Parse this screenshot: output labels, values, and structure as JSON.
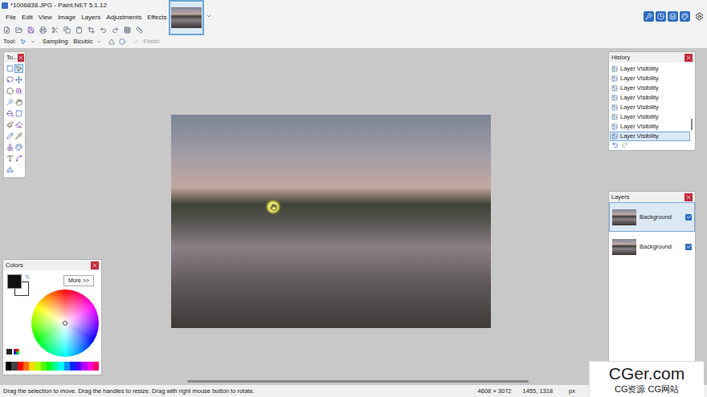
{
  "window": {
    "title": "*1006838.JPG - Paint.NET 5.1.12"
  },
  "menu": [
    "File",
    "Edit",
    "View",
    "Image",
    "Layers",
    "Adjustments",
    "Effects"
  ],
  "toolbar": {
    "tool_label": "Tool:",
    "sampling_label": "Sampling:",
    "sampling_value": "Bicubic",
    "finish": "Finish",
    "finish_disabled": true
  },
  "tools_window": {
    "title": "To..."
  },
  "history": {
    "title": "History",
    "items": [
      {
        "label": "Layer Visibility",
        "selected": false
      },
      {
        "label": "Layer Visibility",
        "selected": false
      },
      {
        "label": "Layer Visibility",
        "selected": false
      },
      {
        "label": "Layer Visibility",
        "selected": false
      },
      {
        "label": "Layer Visibility",
        "selected": false
      },
      {
        "label": "Layer Visibility",
        "selected": false
      },
      {
        "label": "Layer Visibility",
        "selected": false
      },
      {
        "label": "Layer Visibility",
        "selected": true
      }
    ]
  },
  "layers": {
    "title": "Layers",
    "items": [
      {
        "name": "Background",
        "visible": true,
        "selected": true
      },
      {
        "name": "Background",
        "visible": true,
        "selected": false
      }
    ]
  },
  "colors": {
    "title": "Colors",
    "more": "More >>",
    "primary": "#111111",
    "secondary": "#ffffff",
    "palette": [
      "#000000",
      "#404040",
      "#ff0000",
      "#ff6a00",
      "#ffd800",
      "#b6ff00",
      "#4cff00",
      "#00ff21",
      "#00ff90",
      "#00ffff",
      "#0094ff",
      "#0026ff",
      "#4800ff",
      "#b200ff",
      "#ff00dc",
      "#ff006e"
    ]
  },
  "status_bar": {
    "hint": "Drag the selection to move. Drag the handles to resize. Drag with right mouse button to rotate.",
    "size": "4608 × 3072",
    "position": "1455, 1318",
    "unit": "px"
  },
  "watermark": {
    "title": "CGer.com",
    "subtitle": "CG资源 CG网站"
  }
}
